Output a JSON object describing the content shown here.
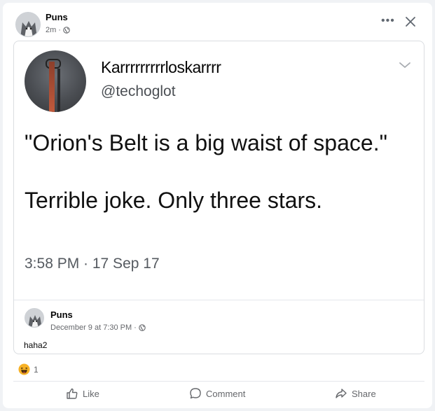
{
  "post": {
    "page_name": "Puns",
    "time": "2m",
    "separator": "·",
    "privacy_icon": "globe-icon",
    "more_label": "•••",
    "close_icon": "close-icon"
  },
  "tweet": {
    "display_name": "Karrrrrrrrrloskarrrr",
    "handle": "@techoglot",
    "text_line1": "\"Orion's Belt is a big waist of space.\"",
    "text_line2": "Terrible joke. Only three stars.",
    "timestamp": "3:58 PM · 17 Sep 17"
  },
  "original_post": {
    "page_name": "Puns",
    "date": "December 9 at 7:30 PM",
    "separator": "·",
    "caption": "haha2"
  },
  "reactions": {
    "icon": "haha-icon",
    "count": "1"
  },
  "actions": {
    "like": "Like",
    "comment": "Comment",
    "share": "Share"
  },
  "colors": {
    "secondary_text": "#65676b",
    "haha_yellow": "#f7b125",
    "divider": "#e4e6eb"
  }
}
